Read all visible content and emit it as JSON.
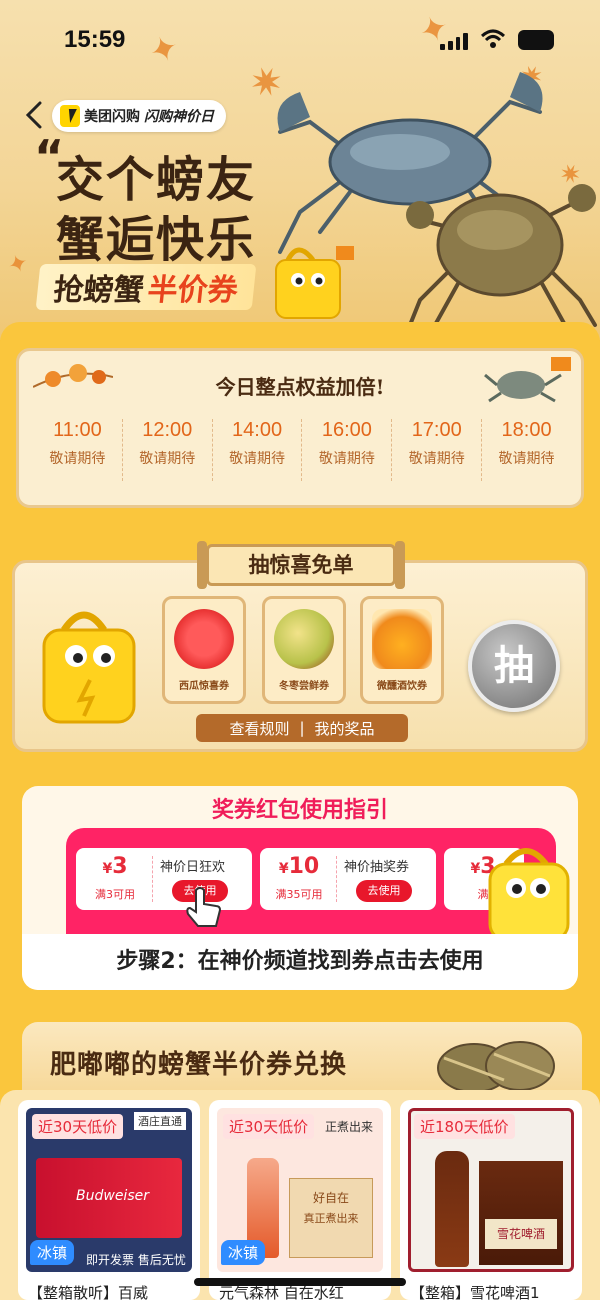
{
  "status_bar": {
    "time": "15:59"
  },
  "header": {
    "brand_name": "美团闪购",
    "brand_sub": "闪购神价日",
    "title_line1": "交个螃友",
    "title_line2": "蟹逅快乐",
    "slogan_prefix": "抢螃蟹",
    "slogan_highlight": "半价券"
  },
  "time_slots": {
    "title": "今日整点权益加倍!",
    "slots": [
      {
        "time": "11:00",
        "status": "敬请期待"
      },
      {
        "time": "12:00",
        "status": "敬请期待"
      },
      {
        "time": "14:00",
        "status": "敬请期待"
      },
      {
        "time": "16:00",
        "status": "敬请期待"
      },
      {
        "time": "17:00",
        "status": "敬请期待"
      },
      {
        "time": "18:00",
        "status": "敬请期待"
      }
    ]
  },
  "lottery": {
    "title": "抽惊喜免单",
    "prizes": [
      {
        "label": "西瓜惊喜券"
      },
      {
        "label": "冬枣尝鲜券"
      },
      {
        "label": "微醺酒饮券"
      }
    ],
    "draw_label": "抽",
    "rules_link": "查看规则",
    "separator": "|",
    "my_prizes_link": "我的奖品"
  },
  "guide": {
    "title": "奖券红包使用指引",
    "coupons": [
      {
        "symbol": "¥",
        "value": "3",
        "condition": "满3可用",
        "name": "神价日狂欢",
        "button": "去使用"
      },
      {
        "symbol": "¥",
        "value": "10",
        "condition": "满35可用",
        "name": "神价抽奖券",
        "button": "去使用"
      },
      {
        "symbol": "¥",
        "value": "3",
        "condition": "满",
        "name": "",
        "button": ""
      }
    ],
    "step_text": "步骤2：在神价频道找到券点击去使用"
  },
  "exchange": {
    "title": "肥嘟嘟的螃蟹半价券兑换",
    "products": [
      {
        "tag": "近30天低价",
        "badge": "冰镇",
        "name": "【整箱散听】百威",
        "store_tag": "酒庄直通",
        "pack_text": "Budweiser",
        "service_text": "即开发票  售后无忧"
      },
      {
        "tag": "近30天低价",
        "badge": "冰镇",
        "name": "元气森林 自在水红",
        "extra_tag": "正煮出来",
        "box_text": "好自在",
        "box_sub": "真正煮出来"
      },
      {
        "tag": "近180天低价",
        "badge": "",
        "name": "【整箱】雪花啤酒1",
        "bottle_text": "雪花啤酒"
      }
    ]
  },
  "colors": {
    "page_bg": "#f9c23c",
    "accent_orange": "#e2661a",
    "guide_pink": "#ff2365",
    "coupon_red": "#e8172b",
    "ice_blue": "#2f8cff"
  }
}
